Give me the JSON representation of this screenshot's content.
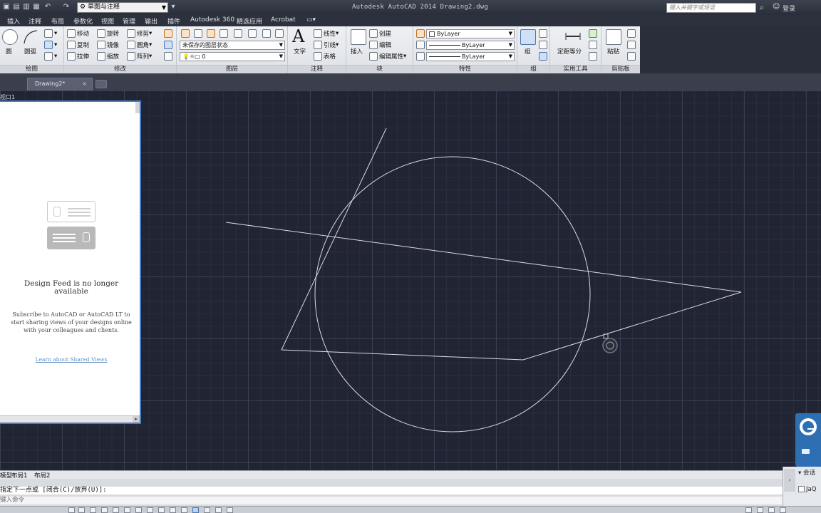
{
  "titlebar": {
    "workspace": "草图与注释",
    "app_title": "Autodesk AutoCAD 2014    Drawing2.dwg",
    "search_placeholder": "键入关键字或短语",
    "login": "登录"
  },
  "menu": [
    "插入",
    "注释",
    "布局",
    "参数化",
    "视图",
    "管理",
    "输出",
    "插件",
    "Autodesk 360",
    "精选应用",
    "Acrobat"
  ],
  "ribbon": {
    "draw": {
      "circle": "圆",
      "arc": "圆弧",
      "label": "绘图"
    },
    "modify": {
      "move": "移动",
      "rotate": "旋转",
      "trim": "修剪",
      "copy": "复制",
      "mirror": "镜像",
      "fillet": "圆角",
      "stretch": "拉伸",
      "scale": "缩放",
      "array": "阵列",
      "label": "修改"
    },
    "layers": {
      "state": "未保存的图层状态",
      "current_layer": "0",
      "label": "图层"
    },
    "annotation": {
      "text": "文字",
      "linear": "线性",
      "leader": "引线",
      "table": "表格",
      "label": "注释"
    },
    "block": {
      "insert": "插入",
      "create": "创建",
      "edit": "编辑",
      "edit_attr": "编辑属性",
      "label": "块"
    },
    "properties": {
      "color": "ByLayer",
      "linetype": "ByLayer",
      "lineweight": "ByLayer",
      "label": "特性"
    },
    "groups": {
      "group": "组",
      "label": "组"
    },
    "utilities": {
      "measure": "定距等分",
      "label": "实用工具"
    },
    "clipboard": {
      "paste": "粘贴",
      "label": "剪贴板"
    }
  },
  "file_tab": {
    "name": "Drawing2*",
    "close": "×"
  },
  "viewport_label": "视口1",
  "feed": {
    "title": "Design Feed is no longer available",
    "description": "Subscribe to AutoCAD or AutoCAD LT to start sharing views of your designs online with your colleagues and clients.",
    "link": "Learn about Shared Views"
  },
  "layout_tabs": [
    "模型",
    "布局1",
    "布局2"
  ],
  "command": {
    "prompt": "指定下一点或 [闭合(C)/放弃(U)]:",
    "input_placeholder": "键入命令"
  },
  "teamviewer": {
    "session": "会话",
    "user": "JaQ"
  },
  "colors": {
    "canvas": "#212432",
    "geometry": "#d9dbe0",
    "palette_border": "#4c7cc4",
    "teamviewer": "#2e6fb4"
  }
}
